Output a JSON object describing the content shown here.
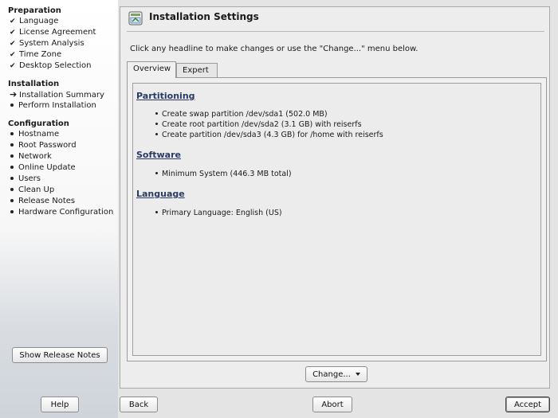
{
  "sidebar": {
    "sections": [
      {
        "title": "Preparation",
        "steps": [
          {
            "label": "Language",
            "status": "done"
          },
          {
            "label": "License Agreement",
            "status": "done"
          },
          {
            "label": "System Analysis",
            "status": "done"
          },
          {
            "label": "Time Zone",
            "status": "done"
          },
          {
            "label": "Desktop Selection",
            "status": "done"
          }
        ]
      },
      {
        "title": "Installation",
        "steps": [
          {
            "label": "Installation Summary",
            "status": "current"
          },
          {
            "label": "Perform Installation",
            "status": "pending"
          }
        ]
      },
      {
        "title": "Configuration",
        "steps": [
          {
            "label": "Hostname",
            "status": "pending"
          },
          {
            "label": "Root Password",
            "status": "pending"
          },
          {
            "label": "Network",
            "status": "pending"
          },
          {
            "label": "Online Update",
            "status": "pending"
          },
          {
            "label": "Users",
            "status": "pending"
          },
          {
            "label": "Clean Up",
            "status": "pending"
          },
          {
            "label": "Release Notes",
            "status": "pending"
          },
          {
            "label": "Hardware Configuration",
            "status": "pending"
          }
        ]
      }
    ],
    "release_notes_button": "Show Release Notes"
  },
  "header": {
    "title": "Installation Settings",
    "icon": "settings-window-icon"
  },
  "instruction": "Click any headline to make changes or use the \"Change...\" menu below.",
  "tabs": [
    {
      "label": "Overview",
      "active": true
    },
    {
      "label": "Expert",
      "active": false
    }
  ],
  "summary": [
    {
      "headline": "Partitioning",
      "items": [
        "Create swap partition /dev/sda1 (502.0 MB)",
        "Create root partition /dev/sda2 (3.1 GB) with reiserfs",
        "Create partition /dev/sda3 (4.3 GB) for /home with reiserfs"
      ]
    },
    {
      "headline": "Software",
      "items": [
        "Minimum System (446.3 MB total)"
      ]
    },
    {
      "headline": "Language",
      "items": [
        "Primary Language: English (US)"
      ]
    }
  ],
  "change_button": "Change...",
  "footer": {
    "help": "Help",
    "back": "Back",
    "abort": "Abort",
    "accept": "Accept"
  },
  "status_glyphs": {
    "done": "✔",
    "current": "➔"
  }
}
